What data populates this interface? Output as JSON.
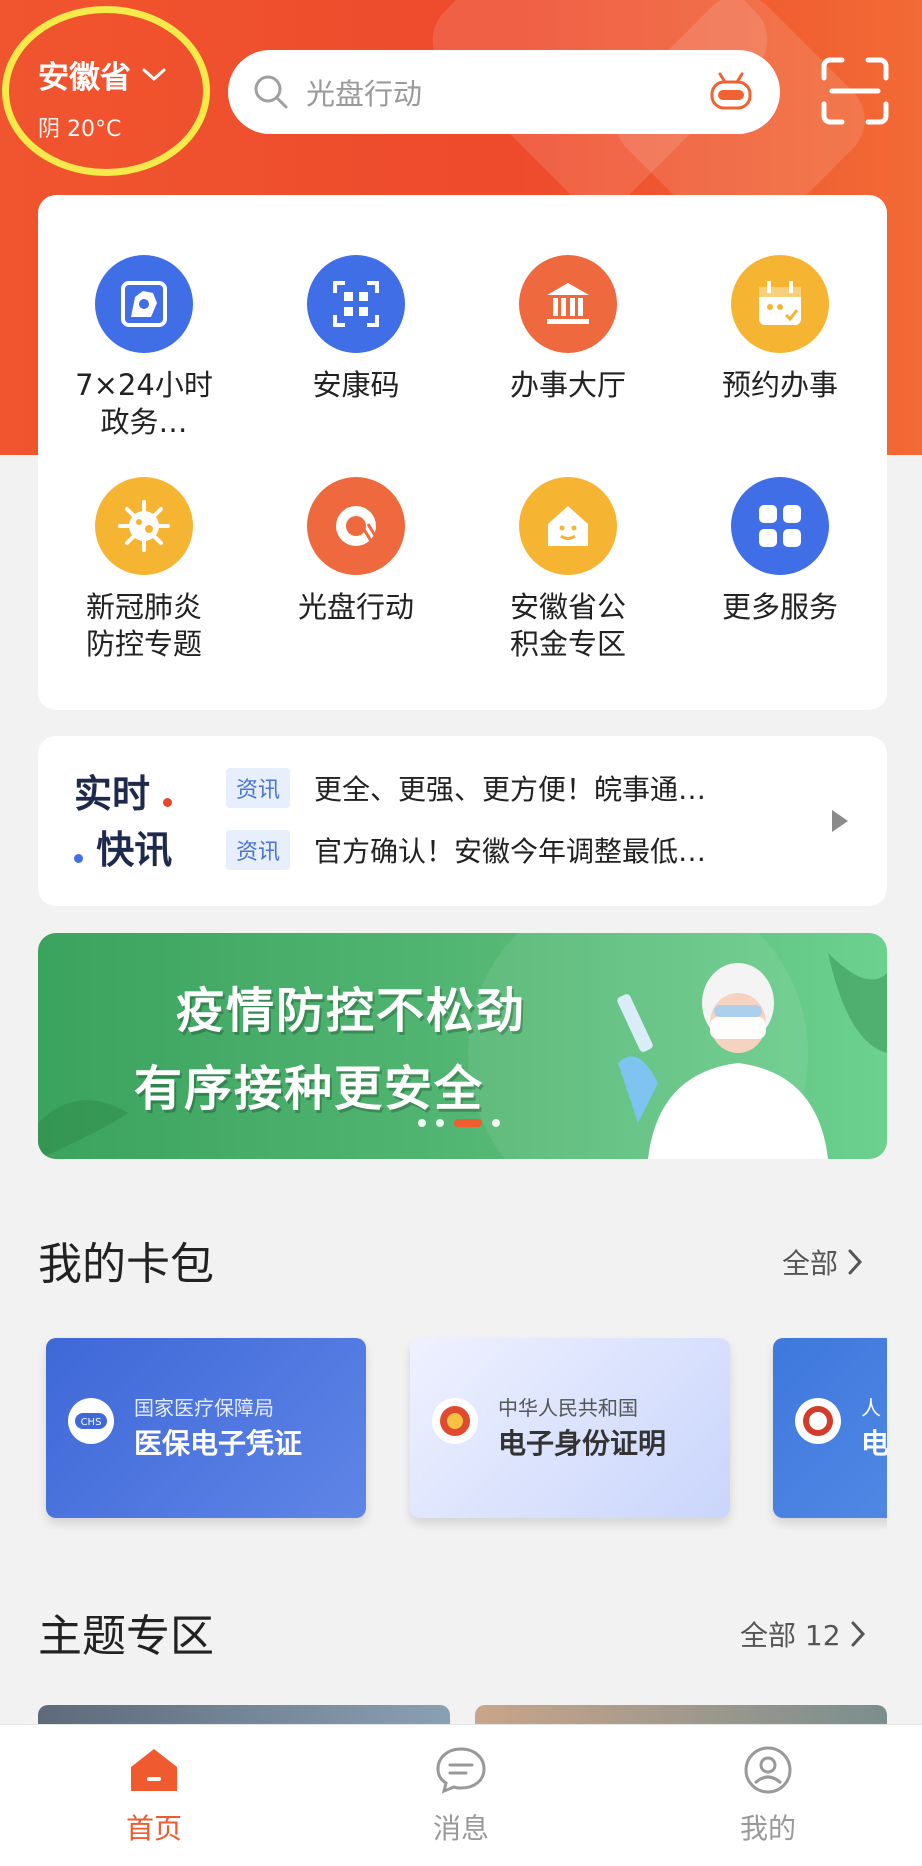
{
  "header": {
    "province": "安徽省",
    "weather": "阴 20°C",
    "search_placeholder": "光盘行动"
  },
  "services": [
    {
      "label": "7×24小时政务…",
      "icon": "map-doc-icon",
      "color": "#3f6ee6"
    },
    {
      "label": "安康码",
      "icon": "qr-code-icon",
      "color": "#3f6ee6"
    },
    {
      "label": "办事大厅",
      "icon": "government-hall-icon",
      "color": "#ee6a3e"
    },
    {
      "label": "预约办事",
      "icon": "calendar-icon",
      "color": "#f5b533"
    },
    {
      "label": "新冠肺炎防控专题",
      "icon": "virus-icon",
      "color": "#f5b533"
    },
    {
      "label": "光盘行动",
      "icon": "plate-icon",
      "color": "#ee6a3e"
    },
    {
      "label": "安徽省公积金专区",
      "icon": "house-fund-icon",
      "color": "#f5b533"
    },
    {
      "label": "更多服务",
      "icon": "more-grid-icon",
      "color": "#3f6ee6"
    }
  ],
  "news": {
    "brand_line1": "实时",
    "brand_line2": "快讯",
    "items": [
      {
        "tag": "资讯",
        "text": "更全、更强、更方便！皖事通…"
      },
      {
        "tag": "资讯",
        "text": "官方确认！安徽今年调整最低…"
      }
    ]
  },
  "banner": {
    "line1": "疫情防控不松劲",
    "line2": "有序接种更安全",
    "slide_index": 3,
    "slide_count": 4
  },
  "wallet": {
    "title": "我的卡包",
    "more_label": "全部",
    "cards": [
      {
        "issuer": "国家医疗保障局",
        "name": "医保电子凭证",
        "emblem": "chs-logo-icon"
      },
      {
        "issuer": "中华人民共和国",
        "name": "电子身份证明",
        "emblem": "national-emblem-icon"
      },
      {
        "issuer": "人",
        "name": "电",
        "emblem": "social-security-emblem-icon"
      }
    ]
  },
  "topics": {
    "title": "主题专区",
    "more_label": "全部 12"
  },
  "tabs": [
    {
      "label": "首页",
      "icon": "home-icon",
      "active": true
    },
    {
      "label": "消息",
      "icon": "message-icon",
      "active": false
    },
    {
      "label": "我的",
      "icon": "profile-icon",
      "active": false
    }
  ],
  "colors": {
    "accent": "#ee4a2c",
    "active_tab": "#ef5a2e",
    "inactive_tab": "#999999"
  }
}
